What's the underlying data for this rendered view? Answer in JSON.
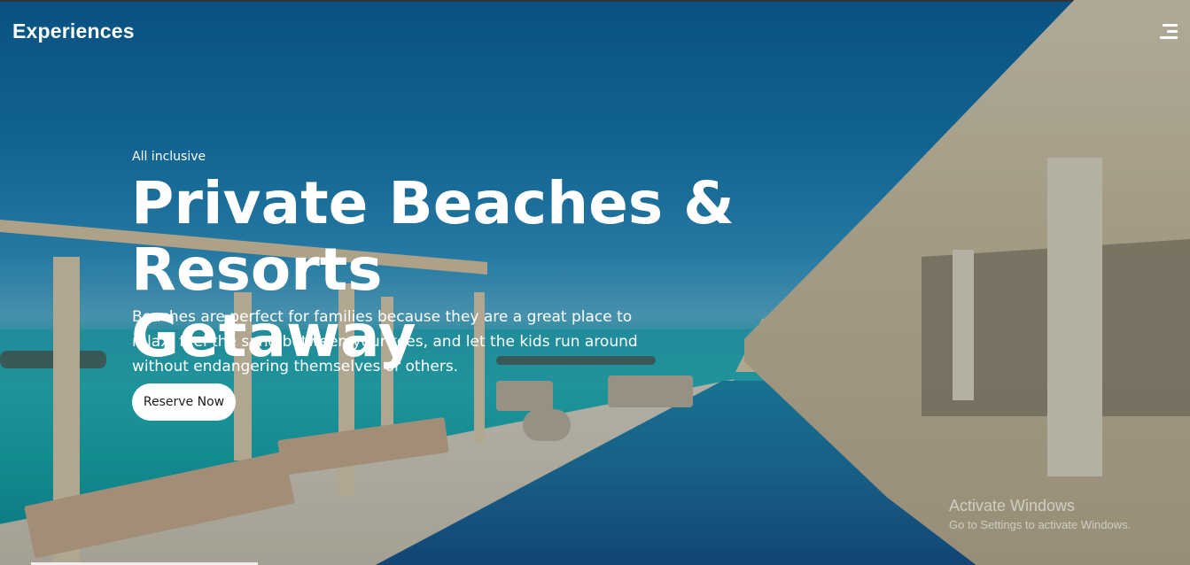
{
  "header": {
    "brand": "Experiences",
    "menu_icon": "hamburger-menu-icon"
  },
  "hero": {
    "eyebrow": "All inclusive",
    "headline_line1": "Private Beaches & Resorts",
    "headline_line2": "Getaway",
    "description": "Beaches are perfect for families because they are a great place to relax, feel the sand between your toes, and let the kids run around without endangering themselves or others.",
    "cta_label": "Reserve Now"
  },
  "watermark": {
    "title": "Activate Windows",
    "subtitle": "Go to Settings to activate Windows."
  },
  "colors": {
    "sky": "#0b5f95",
    "sea": "#1b9ea9",
    "cta_background": "#ffffff",
    "cta_text": "#1a1a1a",
    "text": "#ffffff"
  }
}
